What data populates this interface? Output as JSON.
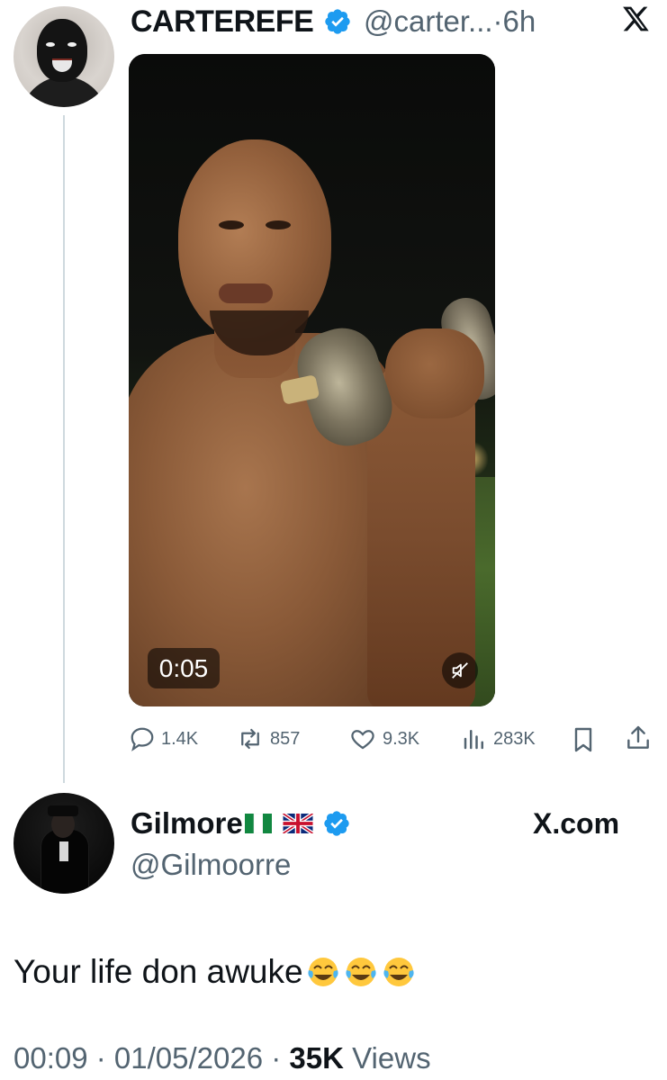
{
  "tweet": {
    "author_name": "CARTEREFE",
    "handle_truncated": "@carter...",
    "separator": "·",
    "time_ago": "6h",
    "media": {
      "duration": "0:05",
      "muted": true
    },
    "actions": {
      "replies": "1.4K",
      "reposts": "857",
      "likes": "9.3K",
      "views": "283K"
    }
  },
  "reply": {
    "author_name": "Gilmore",
    "name_flags": [
      "nigeria-flag",
      "uk-flag"
    ],
    "handle": "@Gilmoorre",
    "source": "X.com",
    "text": "Your life don awuke",
    "emojis": [
      "face-with-tears-of-joy",
      "face-with-tears-of-joy",
      "face-with-tears-of-joy"
    ],
    "time": "00:09",
    "date": "01/05/2026",
    "views_count": "35K",
    "views_label": "Views",
    "separator": " · "
  },
  "colors": {
    "verified_blue": "#1d9bf0",
    "secondary_text": "#536471",
    "primary_text": "#0f1419",
    "thread_line": "#cfd9de"
  }
}
